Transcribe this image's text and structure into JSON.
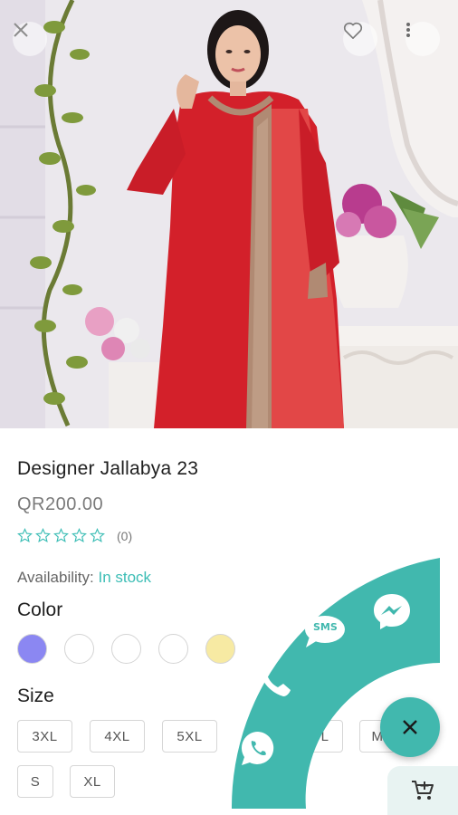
{
  "product": {
    "title": "Designer Jallabya 23",
    "price": "QR200.00",
    "rating_count": "(0)",
    "availability_label": "Availability:",
    "availability_value": "In stock"
  },
  "colors": {
    "label": "Color",
    "swatches": [
      "#8b87f2",
      "#ffffff",
      "#ffffff",
      "#ffffff",
      "#f7eaa3"
    ]
  },
  "sizes": {
    "label": "Size",
    "options": [
      "3XL",
      "4XL",
      "5XL",
      "L",
      "M",
      "S",
      "XL"
    ]
  },
  "contact": {
    "sms_label": "SMS",
    "accent": "#41b8ae"
  },
  "icons": [
    "close-icon",
    "heart-icon",
    "more-vert-icon",
    "star-icon",
    "phone-icon",
    "sms-icon",
    "messenger-icon",
    "whatsapp-icon",
    "cart-add-icon"
  ]
}
